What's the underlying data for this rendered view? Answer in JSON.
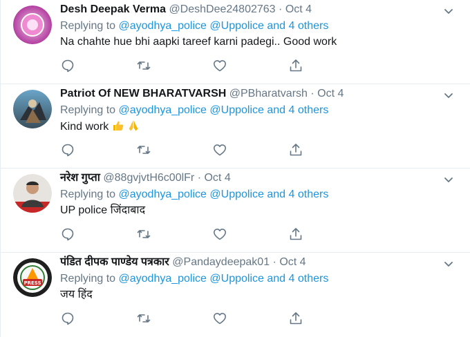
{
  "colors": {
    "link": "#1b95e0",
    "secondary_text": "#657786",
    "primary_text": "#14171a",
    "divider": "#e6ecf0"
  },
  "icons": [
    "chevron-down-icon",
    "reply-icon",
    "retweet-icon",
    "like-icon",
    "share-icon"
  ],
  "tweets": [
    {
      "name": "Desh Deepak Verma",
      "handle": "@DeshDee24802763",
      "separator": "·",
      "date": "Oct 4",
      "replying_to": "Replying to",
      "mention_1": "@ayodhya_police",
      "mention_2": "@Uppolice",
      "and_text": "and",
      "others": "4 others",
      "text": "Na chahte hue bhi aapki tareef karni padegi.. Good  work"
    },
    {
      "name": "Patriot Of NEW BHARATVARSH",
      "handle": "@PBharatvarsh",
      "separator": "·",
      "date": "Oct 4",
      "replying_to": "Replying to",
      "mention_1": "@ayodhya_police",
      "mention_2": "@Uppolice",
      "and_text": "and",
      "others": "4 others",
      "text": "Kind work "
    },
    {
      "name": "नरेश गुप्ता",
      "handle": "@88gvjvtH6c00lFr",
      "separator": "·",
      "date": "Oct 4",
      "replying_to": "Replying to",
      "mention_1": "@ayodhya_police",
      "mention_2": "@Uppolice",
      "and_text": "and",
      "others": "4 others",
      "text": "UP police जिंदाबाद"
    },
    {
      "name": "पंडित दीपक पाण्डेय पत्रकार",
      "handle": "@Pandaydeepak01",
      "separator": "·",
      "date": "Oct 4",
      "replying_to": "Replying to",
      "mention_1": "@ayodhya_police",
      "mention_2": "@Uppolice",
      "and_text": "and",
      "others": "4 others",
      "text": "जय हिंद",
      "avatar_logo_text": "PRESS"
    }
  ]
}
